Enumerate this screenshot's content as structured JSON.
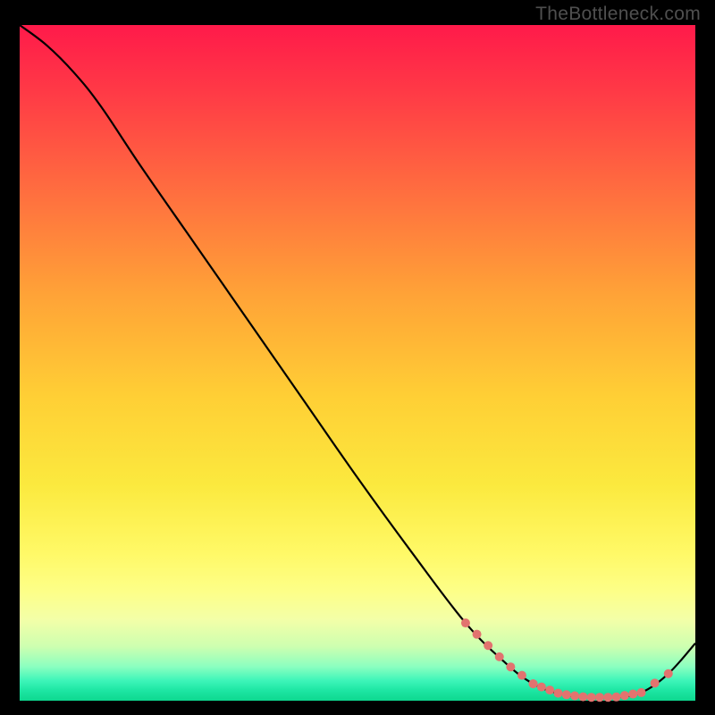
{
  "attribution": "TheBottleneck.com",
  "colors": {
    "curve_stroke": "#000000",
    "marker_fill": "#e2736f",
    "background_black": "#000000"
  },
  "chart_data": {
    "type": "line",
    "title": "",
    "xlabel": "",
    "ylabel": "",
    "xlim": [
      0,
      100
    ],
    "ylim": [
      0,
      100
    ],
    "grid": false,
    "series": [
      {
        "name": "bottleneck-curve",
        "x": [
          0,
          4,
          8,
          12,
          18,
          26,
          34,
          42,
          50,
          58,
          66,
          72,
          76,
          80,
          84,
          88,
          92,
          96,
          100
        ],
        "y": [
          100,
          97,
          93,
          88,
          79,
          67.5,
          56,
          44.5,
          33,
          22,
          11.5,
          5.5,
          2.5,
          1.0,
          0.5,
          0.5,
          1.2,
          4.0,
          8.5
        ]
      }
    ],
    "markers": [
      {
        "name": "descending-cluster",
        "start_x": 66,
        "end_x": 76,
        "count": 7
      },
      {
        "name": "bottom-cluster",
        "start_x": 76,
        "end_x": 92,
        "count": 14
      },
      {
        "name": "rising-pair",
        "start_x": 94,
        "end_x": 96,
        "count": 2
      }
    ],
    "marker_radius": 5
  }
}
